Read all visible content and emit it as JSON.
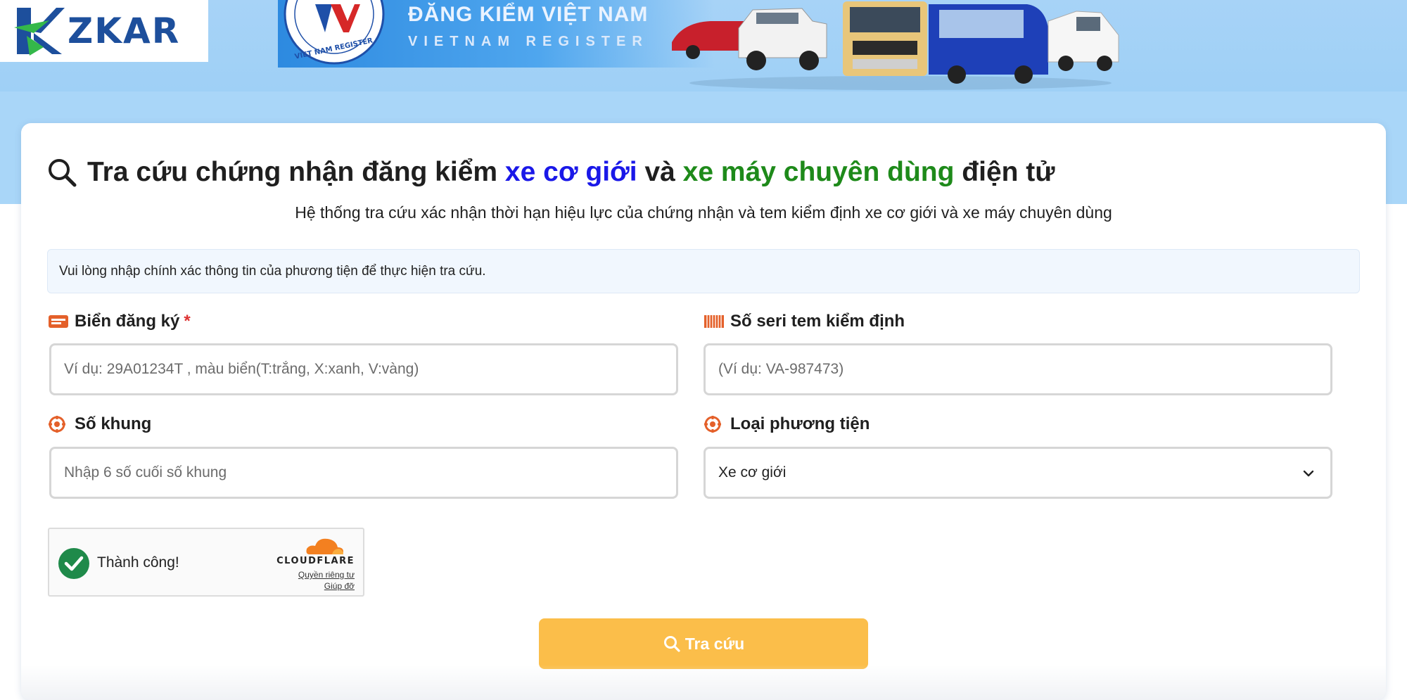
{
  "header": {
    "logo_text": "ZKAR",
    "register_title": "ĐĂNG KIỂM VIỆT NAM",
    "register_subtitle": "VIETNAM REGISTER",
    "seal_text": "VIET NAM REGISTER"
  },
  "page": {
    "title_part1": "Tra cứu chứng nhận đăng kiểm ",
    "title_highlight1": "xe cơ giới",
    "title_part2": " và ",
    "title_highlight2": "xe máy chuyên dùng",
    "title_part3": " điện tử",
    "subtitle": "Hệ thống tra cứu xác nhận thời hạn hiệu lực của chứng nhận và tem kiểm định xe cơ giới và xe máy chuyên dùng",
    "notice": "Vui lòng nhập chính xác thông tin của phương tiện để thực hiện tra cứu."
  },
  "form": {
    "plate": {
      "label": "Biển đăng ký",
      "required_mark": "*",
      "placeholder": "Ví dụ: 29A01234T , màu biển(T:trắng, X:xanh, V:vàng)",
      "value": ""
    },
    "stamp_serial": {
      "label": "Số seri tem kiểm định",
      "placeholder": "(Ví dụ: VA-987473)",
      "value": ""
    },
    "chassis": {
      "label": "Số khung",
      "placeholder": "Nhập 6 số cuối số khung",
      "value": ""
    },
    "vehicle_type": {
      "label": "Loại phương tiện",
      "selected": "Xe cơ giới"
    }
  },
  "captcha": {
    "status": "Thành công!",
    "provider": "CLOUDFLARE",
    "privacy_link": "Quyền riêng tư",
    "help_link": "Giúp đỡ"
  },
  "search_button": {
    "label": "Tra cứu"
  },
  "colors": {
    "highlight_blue": "#1a18e8",
    "highlight_green": "#1e8a1a",
    "button": "#fbbe4a",
    "required": "#dd3333",
    "icon_orange": "#e4602a",
    "success_green": "#1f8a4a"
  },
  "icons": {
    "title": "search-icon",
    "plate": "license-plate-icon",
    "stamp": "stamp-icon",
    "chassis": "chassis-icon",
    "vehicle_type": "vehicle-type-icon",
    "select": "chevron-down-icon",
    "captcha": "check-circle-icon",
    "button": "search-icon"
  }
}
